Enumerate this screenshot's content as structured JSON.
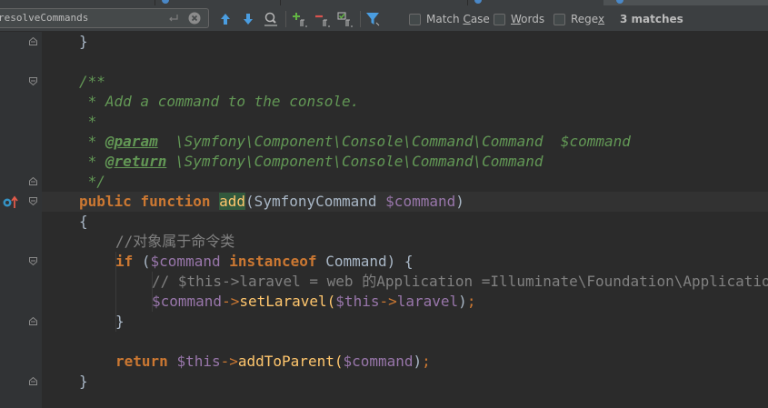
{
  "find_bar": {
    "query": "resolveCommands",
    "options": [
      {
        "label": "Match Case",
        "mnemonic": "C",
        "pre": "Match ",
        "post": "ase",
        "checked": false
      },
      {
        "label": "Words",
        "mnemonic": "W",
        "pre": "",
        "post": "ords",
        "checked": false
      },
      {
        "label": "Regex",
        "mnemonic": "x",
        "pre": "Rege",
        "post": "",
        "checked": false
      }
    ],
    "match_count": "3 matches",
    "icons": [
      "enter-icon",
      "clear-icon",
      "previous-occurrence-icon",
      "next-occurrence-icon",
      "find-all-icon",
      "add-occurrence-icon",
      "remove-occurrence-icon",
      "select-all-occurrences-icon",
      "filter-icon"
    ]
  },
  "code": {
    "l1_brace": "}",
    "l3_doc_open": "/**",
    "l4_doc": " * Add a command to the console.",
    "l5_doc": " *",
    "l6_doc_star": " * ",
    "l6_tag": "@param",
    "l6_text": "  \\Symfony\\Component\\Console\\Command\\Command  $command",
    "l7_doc_star": " * ",
    "l7_tag": "@return",
    "l7_text": " \\Symfony\\Component\\Console\\Command\\Command",
    "l8_doc_close": " */",
    "l9_public": "public",
    "l9_function": "function",
    "l9_name": "add",
    "l9_open": "(SymfonyCommand ",
    "l9_param": "$command",
    "l9_close": ")",
    "l10_brace": "{",
    "l11_comment": "//对象属于命令类",
    "l12_if": "if",
    "l12_open": " (",
    "l12_var": "$command",
    "l12_instanceof": "instanceof",
    "l12_rest": " Command) {",
    "l13_comment": "// $this->laravel = web 的Application =Illuminate\\Foundation\\Application",
    "l14_var": "$command",
    "l14_arrow": "->",
    "l14_method": "setLaravel(",
    "l14_this": "$this",
    "l14_arrow2": "->",
    "l14_prop": "laravel",
    "l14_end": ")",
    "l14_semi": ";",
    "l15_brace": "}",
    "l17_return": "return",
    "l17_this": "$this",
    "l17_arrow": "->",
    "l17_method": "addToParent(",
    "l17_param": "$command",
    "l17_end": ")",
    "l17_semi": ";",
    "l18_brace": "}"
  },
  "gutter": {
    "marker_icons": [
      "implements-method-icon",
      "go-to-parent-icon"
    ]
  }
}
